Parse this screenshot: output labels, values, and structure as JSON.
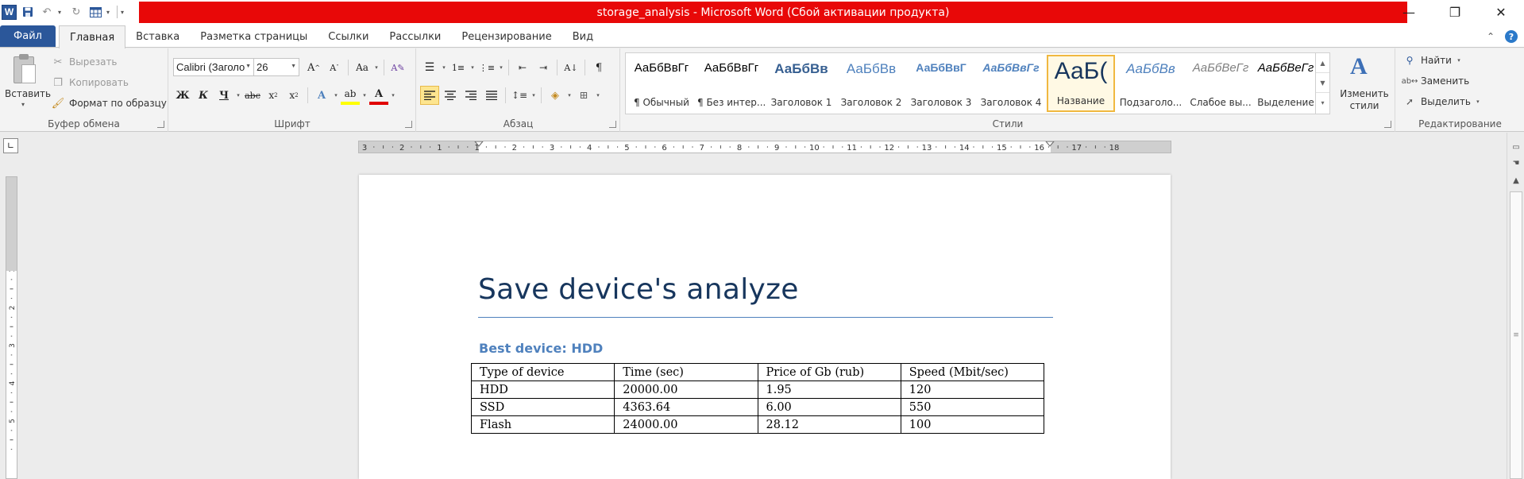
{
  "app": {
    "logo_letter": "W",
    "title": "storage_analysis  -  Microsoft Word (Сбой активации продукта)",
    "title_color": "#e80808"
  },
  "quick_access": {
    "icons": [
      "save-icon",
      "undo-icon",
      "redo-icon",
      "table-icon",
      "customize-icon"
    ]
  },
  "window_controls": {
    "minimize": "—",
    "restore": "❐",
    "close": "✕"
  },
  "tabs": {
    "file": "Файл",
    "items": [
      "Главная",
      "Вставка",
      "Разметка страницы",
      "Ссылки",
      "Рассылки",
      "Рецензирование",
      "Вид"
    ],
    "active": "Главная",
    "file_color": "#2b579a"
  },
  "ribbon": {
    "clipboard": {
      "paste": "Вставить",
      "cut": "Вырезать",
      "copy": "Копировать",
      "format_painter": "Формат по образцу",
      "label": "Буфер обмена"
    },
    "font": {
      "font_name": "Calibri (Заголо",
      "font_size": "26",
      "label": "Шрифт"
    },
    "paragraph": {
      "label": "Абзац",
      "active_alignment": "left"
    },
    "styles": {
      "label": "Стили",
      "items": [
        {
          "sample": "АаБбВвГг",
          "name": "¶ Обычный"
        },
        {
          "sample": "АаБбВвГг",
          "name": "¶ Без интер..."
        },
        {
          "sample": "АаБбВв",
          "name": "Заголовок 1"
        },
        {
          "sample": "АаБбВв",
          "name": "Заголовок 2"
        },
        {
          "sample": "АаБбВвГ",
          "name": "Заголовок 3"
        },
        {
          "sample": "АаБбВвГг",
          "name": "Заголовок 4"
        },
        {
          "sample": "АаБ(",
          "name": "Название"
        },
        {
          "sample": "АаБбВв",
          "name": "Подзаголо..."
        },
        {
          "sample": "АаБбВеГг",
          "name": "Слабое вы..."
        },
        {
          "sample": "АаБбВеГг",
          "name": "Выделение"
        }
      ],
      "selected": "Название",
      "change_styles_line1": "Изменить",
      "change_styles_line2": "стили"
    },
    "editing": {
      "find": "Найти",
      "replace": "Заменить",
      "select": "Выделить",
      "label": "Редактирование"
    }
  },
  "ruler": {
    "numbers": [
      "3",
      "2",
      "1",
      "1",
      "2",
      "3",
      "4",
      "5",
      "6",
      "7",
      "8",
      "9",
      "10",
      "11",
      "12",
      "13",
      "14",
      "15",
      "16",
      "17",
      "18"
    ],
    "vertical_numbers": [
      "2",
      "1",
      "1",
      "2",
      "3",
      "4",
      "5"
    ]
  },
  "document": {
    "title": "Save device's analyze",
    "heading": "Best device: HDD",
    "title_color": "#17365d",
    "heading_color": "#4f81bd",
    "table": {
      "header": [
        "Type of device",
        "Time (sec)",
        "Price of Gb (rub)",
        "Speed (Mbit/sec)"
      ],
      "rows": [
        [
          "HDD",
          "20000.00",
          "1.95",
          "120"
        ],
        [
          "SSD",
          "4363.64",
          "6.00",
          "550"
        ],
        [
          "Flash",
          "24000.00",
          "28.12",
          "100"
        ]
      ]
    }
  }
}
